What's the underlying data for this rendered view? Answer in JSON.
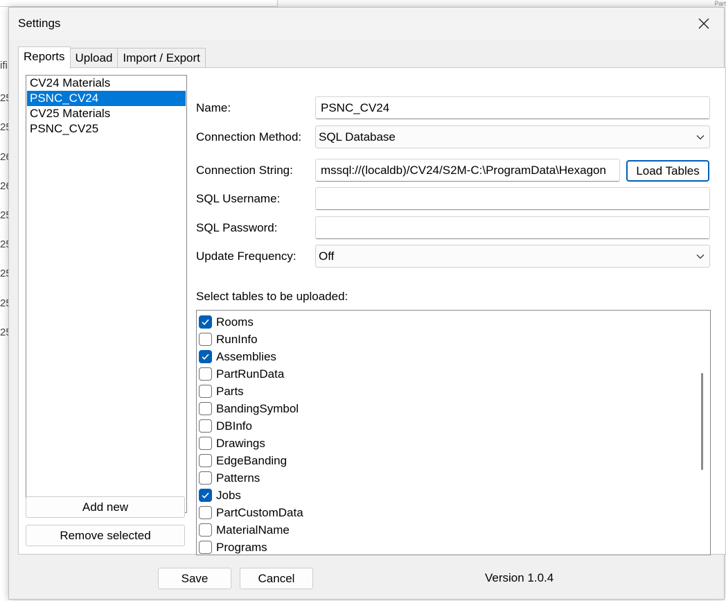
{
  "background_fragments": [
    "ifi",
    "25",
    "25",
    "26",
    "26",
    "25",
    "25",
    "25",
    "25",
    "25"
  ],
  "background_corner": "Part",
  "dialog": {
    "title": "Settings",
    "close_icon": "close-icon"
  },
  "tabs": [
    {
      "label": "Reports",
      "active": true
    },
    {
      "label": "Upload",
      "active": false
    },
    {
      "label": "Import / Export",
      "active": false
    }
  ],
  "reports": {
    "items": [
      "CV24 Materials",
      "PSNC_CV24",
      "CV25 Materials",
      "PSNC_CV25"
    ],
    "selected_index": 1,
    "add_label": "Add new",
    "remove_label": "Remove selected"
  },
  "form": {
    "name_label": "Name:",
    "name_value": "PSNC_CV24",
    "connection_method_label": "Connection Method:",
    "connection_method_value": "SQL Database",
    "connection_string_label": "Connection String:",
    "connection_string_value": "mssql://(localdb)/CV24/S2M-C:\\ProgramData\\Hexagon",
    "load_tables_label": "Load Tables",
    "sql_username_label": "SQL Username:",
    "sql_username_value": "",
    "sql_password_label": "SQL Password:",
    "sql_password_value": "",
    "update_frequency_label": "Update Frequency:",
    "update_frequency_value": "Off",
    "dropdown_icon": "chevron-down-icon"
  },
  "tables": {
    "heading": "Select tables to be uploaded:",
    "items": [
      {
        "name": "Rooms",
        "checked": true
      },
      {
        "name": "RunInfo",
        "checked": false
      },
      {
        "name": "Assemblies",
        "checked": true
      },
      {
        "name": "PartRunData",
        "checked": false
      },
      {
        "name": "Parts",
        "checked": false
      },
      {
        "name": "BandingSymbol",
        "checked": false
      },
      {
        "name": "DBInfo",
        "checked": false
      },
      {
        "name": "Drawings",
        "checked": false
      },
      {
        "name": "EdgeBanding",
        "checked": false
      },
      {
        "name": "Patterns",
        "checked": false
      },
      {
        "name": "Jobs",
        "checked": true
      },
      {
        "name": "PartCustomData",
        "checked": false
      },
      {
        "name": "MaterialName",
        "checked": false
      },
      {
        "name": "Programs",
        "checked": false
      }
    ]
  },
  "footer": {
    "save_label": "Save",
    "cancel_label": "Cancel",
    "version": "Version 1.0.4"
  },
  "colors": {
    "accent": "#005fb8",
    "selection": "#0078d7"
  }
}
